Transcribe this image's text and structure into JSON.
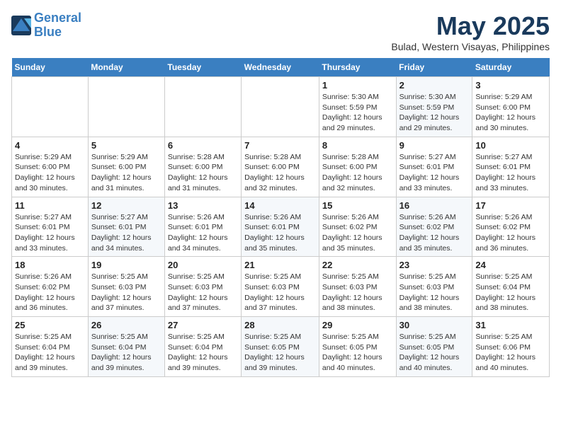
{
  "logo": {
    "line1": "General",
    "line2": "Blue"
  },
  "title": "May 2025",
  "location": "Bulad, Western Visayas, Philippines",
  "days_of_week": [
    "Sunday",
    "Monday",
    "Tuesday",
    "Wednesday",
    "Thursday",
    "Friday",
    "Saturday"
  ],
  "weeks": [
    [
      {
        "day": "",
        "info": ""
      },
      {
        "day": "",
        "info": ""
      },
      {
        "day": "",
        "info": ""
      },
      {
        "day": "",
        "info": ""
      },
      {
        "day": "1",
        "info": "Sunrise: 5:30 AM\nSunset: 5:59 PM\nDaylight: 12 hours\nand 29 minutes."
      },
      {
        "day": "2",
        "info": "Sunrise: 5:30 AM\nSunset: 5:59 PM\nDaylight: 12 hours\nand 29 minutes."
      },
      {
        "day": "3",
        "info": "Sunrise: 5:29 AM\nSunset: 6:00 PM\nDaylight: 12 hours\nand 30 minutes."
      }
    ],
    [
      {
        "day": "4",
        "info": "Sunrise: 5:29 AM\nSunset: 6:00 PM\nDaylight: 12 hours\nand 30 minutes."
      },
      {
        "day": "5",
        "info": "Sunrise: 5:29 AM\nSunset: 6:00 PM\nDaylight: 12 hours\nand 31 minutes."
      },
      {
        "day": "6",
        "info": "Sunrise: 5:28 AM\nSunset: 6:00 PM\nDaylight: 12 hours\nand 31 minutes."
      },
      {
        "day": "7",
        "info": "Sunrise: 5:28 AM\nSunset: 6:00 PM\nDaylight: 12 hours\nand 32 minutes."
      },
      {
        "day": "8",
        "info": "Sunrise: 5:28 AM\nSunset: 6:00 PM\nDaylight: 12 hours\nand 32 minutes."
      },
      {
        "day": "9",
        "info": "Sunrise: 5:27 AM\nSunset: 6:01 PM\nDaylight: 12 hours\nand 33 minutes."
      },
      {
        "day": "10",
        "info": "Sunrise: 5:27 AM\nSunset: 6:01 PM\nDaylight: 12 hours\nand 33 minutes."
      }
    ],
    [
      {
        "day": "11",
        "info": "Sunrise: 5:27 AM\nSunset: 6:01 PM\nDaylight: 12 hours\nand 33 minutes."
      },
      {
        "day": "12",
        "info": "Sunrise: 5:27 AM\nSunset: 6:01 PM\nDaylight: 12 hours\nand 34 minutes."
      },
      {
        "day": "13",
        "info": "Sunrise: 5:26 AM\nSunset: 6:01 PM\nDaylight: 12 hours\nand 34 minutes."
      },
      {
        "day": "14",
        "info": "Sunrise: 5:26 AM\nSunset: 6:01 PM\nDaylight: 12 hours\nand 35 minutes."
      },
      {
        "day": "15",
        "info": "Sunrise: 5:26 AM\nSunset: 6:02 PM\nDaylight: 12 hours\nand 35 minutes."
      },
      {
        "day": "16",
        "info": "Sunrise: 5:26 AM\nSunset: 6:02 PM\nDaylight: 12 hours\nand 35 minutes."
      },
      {
        "day": "17",
        "info": "Sunrise: 5:26 AM\nSunset: 6:02 PM\nDaylight: 12 hours\nand 36 minutes."
      }
    ],
    [
      {
        "day": "18",
        "info": "Sunrise: 5:26 AM\nSunset: 6:02 PM\nDaylight: 12 hours\nand 36 minutes."
      },
      {
        "day": "19",
        "info": "Sunrise: 5:25 AM\nSunset: 6:03 PM\nDaylight: 12 hours\nand 37 minutes."
      },
      {
        "day": "20",
        "info": "Sunrise: 5:25 AM\nSunset: 6:03 PM\nDaylight: 12 hours\nand 37 minutes."
      },
      {
        "day": "21",
        "info": "Sunrise: 5:25 AM\nSunset: 6:03 PM\nDaylight: 12 hours\nand 37 minutes."
      },
      {
        "day": "22",
        "info": "Sunrise: 5:25 AM\nSunset: 6:03 PM\nDaylight: 12 hours\nand 38 minutes."
      },
      {
        "day": "23",
        "info": "Sunrise: 5:25 AM\nSunset: 6:03 PM\nDaylight: 12 hours\nand 38 minutes."
      },
      {
        "day": "24",
        "info": "Sunrise: 5:25 AM\nSunset: 6:04 PM\nDaylight: 12 hours\nand 38 minutes."
      }
    ],
    [
      {
        "day": "25",
        "info": "Sunrise: 5:25 AM\nSunset: 6:04 PM\nDaylight: 12 hours\nand 39 minutes."
      },
      {
        "day": "26",
        "info": "Sunrise: 5:25 AM\nSunset: 6:04 PM\nDaylight: 12 hours\nand 39 minutes."
      },
      {
        "day": "27",
        "info": "Sunrise: 5:25 AM\nSunset: 6:04 PM\nDaylight: 12 hours\nand 39 minutes."
      },
      {
        "day": "28",
        "info": "Sunrise: 5:25 AM\nSunset: 6:05 PM\nDaylight: 12 hours\nand 39 minutes."
      },
      {
        "day": "29",
        "info": "Sunrise: 5:25 AM\nSunset: 6:05 PM\nDaylight: 12 hours\nand 40 minutes."
      },
      {
        "day": "30",
        "info": "Sunrise: 5:25 AM\nSunset: 6:05 PM\nDaylight: 12 hours\nand 40 minutes."
      },
      {
        "day": "31",
        "info": "Sunrise: 5:25 AM\nSunset: 6:06 PM\nDaylight: 12 hours\nand 40 minutes."
      }
    ]
  ]
}
